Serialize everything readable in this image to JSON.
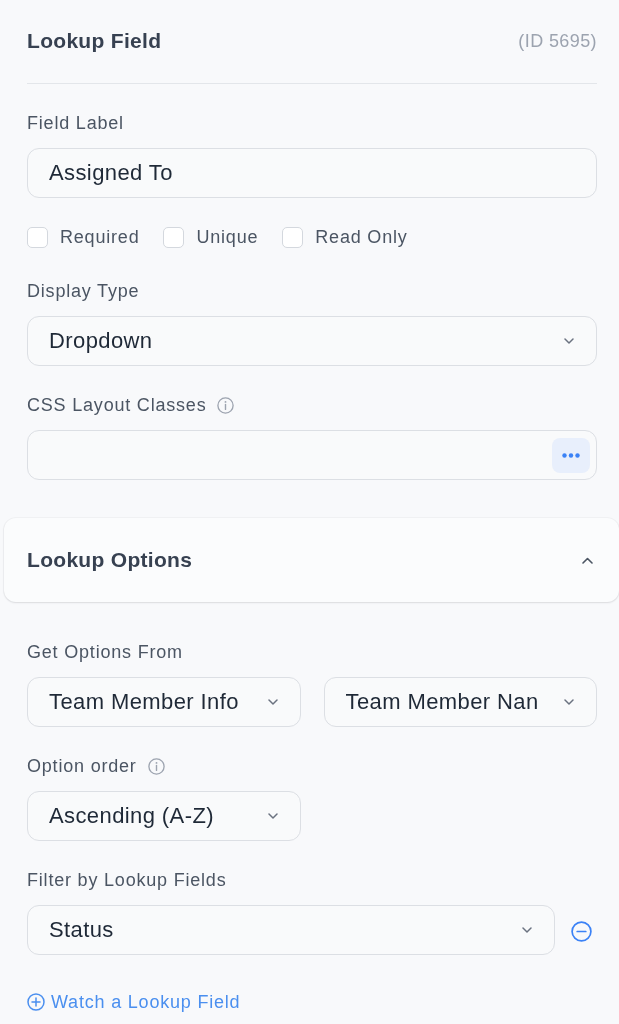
{
  "panel": {
    "title": "Lookup Field",
    "id_label": "(ID 5695)"
  },
  "field_label": {
    "label": "Field Label",
    "info": false,
    "value": "Assigned To"
  },
  "flags": [
    {
      "label": "Required",
      "checked": false
    },
    {
      "label": "Unique",
      "checked": false
    },
    {
      "label": "Read Only",
      "checked": false
    }
  ],
  "display_type": {
    "label": "Display Type",
    "info": false,
    "value": "Dropdown"
  },
  "css_layout_classes": {
    "label": "CSS Layout Classes",
    "info": true
  },
  "lookup_options": {
    "title": "Lookup Options",
    "expanded": true,
    "get_options_from": {
      "label": "Get Options From",
      "info": false,
      "sources": [
        "Team Member Info",
        "Team Member Nan"
      ]
    },
    "option_order": {
      "label": "Option order",
      "info": true,
      "value": "Ascending (A-Z)"
    },
    "filter_by_lookup_fields": {
      "label": "Filter by Lookup Fields",
      "info": false,
      "filters": [
        {
          "value": "Status"
        }
      ]
    },
    "watch_link": "Watch a Lookup Field"
  }
}
